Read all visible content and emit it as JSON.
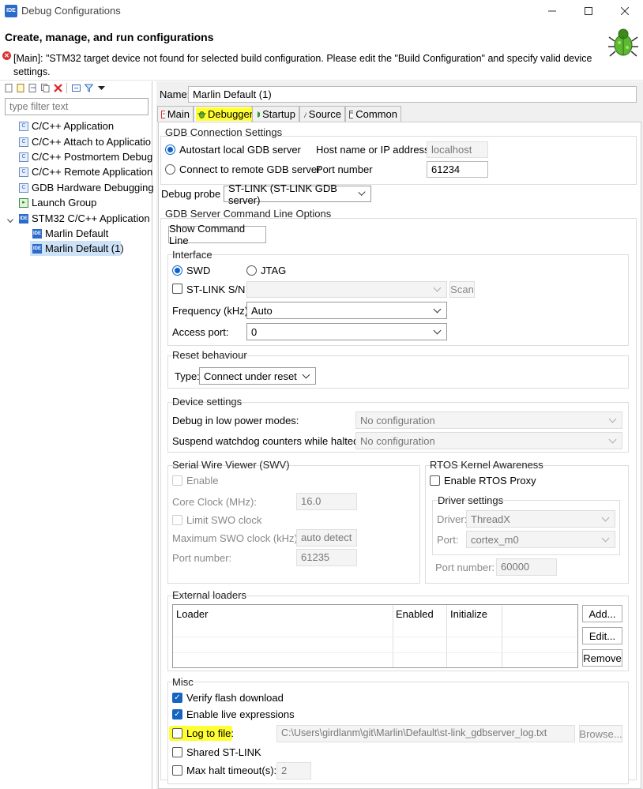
{
  "window": {
    "title": "Debug Configurations",
    "logo": "IDE"
  },
  "header": {
    "title": "Create, manage, and run configurations",
    "error": "[Main]: \"STM32 target device not found for selected build configuration. Please edit the \"Build Configuration\" and specify valid device settings."
  },
  "left": {
    "filter_placeholder": "type filter text",
    "items": [
      {
        "label": "C/C++ Application"
      },
      {
        "label": "C/C++ Attach to Applicatio"
      },
      {
        "label": "C/C++ Postmortem Debug"
      },
      {
        "label": "C/C++ Remote Application"
      },
      {
        "label": "GDB Hardware Debugging"
      },
      {
        "label": "Launch Group"
      },
      {
        "label": "STM32 C/C++ Application"
      },
      {
        "label": "Marlin Default"
      },
      {
        "label": "Marlin Default (1)"
      }
    ]
  },
  "name_label": "Name:",
  "name_value": "Marlin Default (1)",
  "tabs": [
    "Main",
    "Debugger",
    "Startup",
    "Source",
    "Common"
  ],
  "gdb": {
    "title": "GDB Connection Settings",
    "autostart": "Autostart local GDB server",
    "remote": "Connect to remote GDB server",
    "host_label": "Host name or IP address",
    "host_value": "localhost",
    "port_label": "Port number",
    "port_value": "61234"
  },
  "probe": {
    "label": "Debug probe",
    "value": "ST-LINK (ST-LINK GDB server)"
  },
  "server": {
    "title": "GDB Server Command Line Options",
    "show_cmd": "Show Command Line"
  },
  "interface": {
    "title": "Interface",
    "swd": "SWD",
    "jtag": "JTAG",
    "stlink_sn": "ST-LINK S/N",
    "scan": "Scan",
    "freq_label": "Frequency (kHz):",
    "freq_value": "Auto",
    "access_label": "Access port:",
    "access_value": "0"
  },
  "reset": {
    "title": "Reset behaviour",
    "type_label": "Type:",
    "type_value": "Connect under reset"
  },
  "device": {
    "title": "Device settings",
    "low_power_label": "Debug in low power modes:",
    "low_power_value": "No configuration",
    "watchdog_label": "Suspend watchdog counters while halted:",
    "watchdog_value": "No configuration"
  },
  "swv": {
    "title": "Serial Wire Viewer (SWV)",
    "enable": "Enable",
    "core_clock_label": "Core Clock (MHz):",
    "core_clock_value": "16.0",
    "limit_swo": "Limit SWO clock",
    "max_swo_label": "Maximum SWO clock (kHz):",
    "max_swo_value": "auto detect",
    "port_label": "Port number:",
    "port_value": "61235"
  },
  "rtos": {
    "title": "RTOS Kernel Awareness",
    "enable": "Enable RTOS Proxy",
    "driver_title": "Driver settings",
    "driver_label": "Driver:",
    "driver_value": "ThreadX",
    "port_label": "Port:",
    "port_value": "cortex_m0",
    "port_number_label": "Port number:",
    "port_number_value": "60000"
  },
  "loaders": {
    "title": "External loaders",
    "columns": [
      "Loader",
      "Enabled",
      "Initialize"
    ],
    "add": "Add...",
    "edit": "Edit...",
    "remove": "Remove"
  },
  "misc": {
    "title": "Misc",
    "verify": "Verify flash download",
    "live": "Enable live expressions",
    "log": "Log to file:",
    "log_path": "C:\\Users\\girdlanm\\git\\Marlin\\Default\\st-link_gdbserver_log.txt",
    "browse": "Browse...",
    "shared": "Shared ST-LINK",
    "max_halt": "Max halt timeout(s):",
    "max_halt_value": "2"
  },
  "colors": {
    "highlight": "#ffff33",
    "accent": "#1565c0",
    "error": "#d33333"
  }
}
